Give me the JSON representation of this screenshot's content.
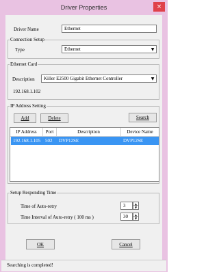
{
  "window": {
    "title": "Driver Properties",
    "close_glyph": "×"
  },
  "driver": {
    "name_label": "Driver Name",
    "name_value": "Ethernet"
  },
  "connection": {
    "legend": "Connection Setup",
    "type_label": "Type",
    "type_value": "Ethernet"
  },
  "ethernet_card": {
    "legend": "Ethernet Card",
    "description_label": "Description",
    "description_value": "Killer E2500 Gigabit Ethernet Controller",
    "ip": "192.168.1.102"
  },
  "ip_setting": {
    "legend": "IP Address Setting",
    "add_label": "Add",
    "delete_label": "Delete",
    "search_label": "Search",
    "columns": [
      "IP Address",
      "Port",
      "Description",
      "Device Name"
    ],
    "rows": [
      [
        "192.168.1.105",
        "502",
        "DVP12SE",
        "DVP12SE"
      ]
    ]
  },
  "responding": {
    "legend": "Setup Responding Time",
    "auto_retry_label": "Time of Auto-retry",
    "auto_retry_value": "3",
    "interval_label": "Time Interval of Auto-retry ( 100 ms )",
    "interval_value": "30"
  },
  "buttons": {
    "ok": "OK",
    "cancel": "Cancel"
  },
  "status": {
    "text": "Searching is completed!"
  },
  "colors": {
    "frame": "#e9c2e2",
    "close": "#e0414a",
    "selection": "#3a95f3"
  }
}
